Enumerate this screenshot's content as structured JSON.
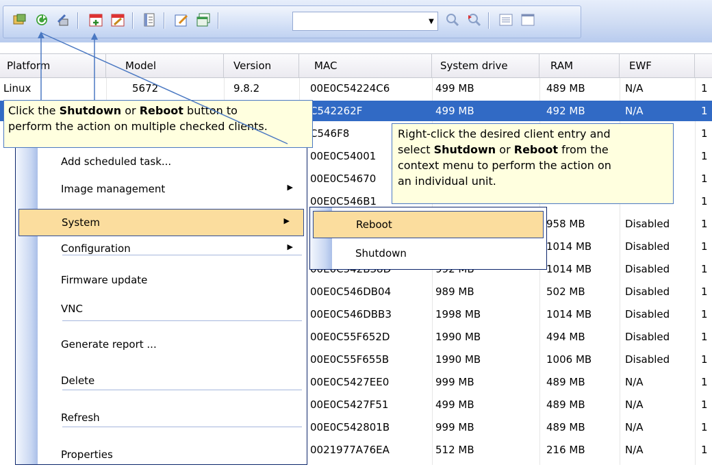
{
  "toolbar": {
    "icons": [
      "client-list-icon",
      "refresh-icon",
      "wrench-icon",
      "calendar-add-icon",
      "calendar-edit-icon",
      "report-icon",
      "edit-icon",
      "window-icon",
      "search-icon",
      "search-next-icon",
      "list-view-icon",
      "panel-icon"
    ],
    "combo_value": ""
  },
  "grid": {
    "headers": [
      "Platform",
      "Model",
      "Version",
      "MAC",
      "System drive",
      "RAM",
      "EWF"
    ],
    "rows": [
      {
        "platform": "Linux",
        "model": "5672",
        "version": "9.8.2",
        "mac": "00E0C54224C6",
        "drive": "499 MB",
        "ram": "489 MB",
        "ewf": "N/A",
        "extra": "1"
      },
      {
        "platform": "",
        "model": "",
        "version": "",
        "mac": "C542262F",
        "drive": "499 MB",
        "ram": "492 MB",
        "ewf": "N/A",
        "extra": "1"
      },
      {
        "platform": "",
        "model": "",
        "version": "",
        "mac": "C546F8",
        "drive": "",
        "ram": "",
        "ewf": "",
        "extra": "1"
      },
      {
        "platform": "",
        "model": "",
        "version": "",
        "mac": "00E0C54001",
        "drive": "",
        "ram": "",
        "ewf": "",
        "extra": "1"
      },
      {
        "platform": "",
        "model": "",
        "version": "",
        "mac": "00E0C54670",
        "drive": "",
        "ram": "",
        "ewf": "",
        "extra": "1"
      },
      {
        "platform": "",
        "model": "",
        "version": "",
        "mac": "00E0C546B1",
        "drive": "",
        "ram": "",
        "ewf": "",
        "extra": "1"
      },
      {
        "platform": "",
        "model": "",
        "version": "",
        "mac": "",
        "drive": "",
        "ram": "958 MB",
        "ewf": "Disabled",
        "extra": "1"
      },
      {
        "platform": "",
        "model": "",
        "version": "",
        "mac": "",
        "drive": "",
        "ram": "1014 MB",
        "ewf": "Disabled",
        "extra": "1"
      },
      {
        "platform": "",
        "model": "",
        "version": "",
        "mac": "00E0C542B38D",
        "drive": "992 MB",
        "ram": "1014 MB",
        "ewf": "Disabled",
        "extra": "1"
      },
      {
        "platform": "",
        "model": "",
        "version": "",
        "mac": "00E0C546DB04",
        "drive": "989 MB",
        "ram": "502 MB",
        "ewf": "Disabled",
        "extra": "1"
      },
      {
        "platform": "",
        "model": "",
        "version": "",
        "mac": "00E0C546DBB3",
        "drive": "1998 MB",
        "ram": "1014 MB",
        "ewf": "Disabled",
        "extra": "1"
      },
      {
        "platform": "",
        "model": "",
        "version": "",
        "mac": "00E0C55F652D",
        "drive": "1990 MB",
        "ram": "494 MB",
        "ewf": "Disabled",
        "extra": "1"
      },
      {
        "platform": "",
        "model": "",
        "version": "",
        "mac": "00E0C55F655B",
        "drive": "1990 MB",
        "ram": "1006 MB",
        "ewf": "Disabled",
        "extra": "1"
      },
      {
        "platform": "",
        "model": "",
        "version": "",
        "mac": "00E0C5427EE0",
        "drive": "999 MB",
        "ram": "489 MB",
        "ewf": "N/A",
        "extra": "1"
      },
      {
        "platform": "",
        "model": "",
        "version": "",
        "mac": "00E0C5427F51",
        "drive": "499 MB",
        "ram": "489 MB",
        "ewf": "N/A",
        "extra": "1"
      },
      {
        "platform": "",
        "model": "",
        "version": "",
        "mac": "00E0C542801B",
        "drive": "999 MB",
        "ram": "489 MB",
        "ewf": "N/A",
        "extra": "1"
      },
      {
        "platform": "",
        "model": "",
        "version": "",
        "mac": "0021977A76EA",
        "drive": "512 MB",
        "ram": "216 MB",
        "ewf": "N/A",
        "extra": "1"
      }
    ]
  },
  "context_menu": {
    "items": [
      {
        "label": "Add scheduled task...",
        "submenu": false
      },
      {
        "label": "Image management",
        "submenu": true
      },
      {
        "label": "System",
        "submenu": true,
        "active": true
      },
      {
        "label": "Configuration",
        "submenu": true
      },
      {
        "label": "Firmware update",
        "submenu": false
      },
      {
        "label": "VNC",
        "submenu": false
      },
      {
        "label": "Generate report ...",
        "submenu": false
      },
      {
        "label": "Delete",
        "submenu": false
      },
      {
        "label": "Refresh",
        "submenu": false
      },
      {
        "label": "Properties",
        "submenu": false
      }
    ]
  },
  "submenu": {
    "items": [
      {
        "label": "Reboot",
        "active": true
      },
      {
        "label": "Shutdown",
        "active": false
      }
    ]
  },
  "callouts": {
    "toolbar_pre": "Click the ",
    "toolbar_b1": "Shutdown",
    "toolbar_mid": " or ",
    "toolbar_b2": "Reboot",
    "toolbar_post": " button to",
    "toolbar_line2": "perform the action on multiple checked clients.",
    "ctx_line1": "Right-click the desired client entry and",
    "ctx_pre": "select ",
    "ctx_b1": "Shutdown",
    "ctx_mid": " or ",
    "ctx_b2": "Reboot",
    "ctx_post": " from the",
    "ctx_line3": "context menu to perform the action on",
    "ctx_line4": "an individual unit."
  },
  "colors": {
    "selection": "#316ac5",
    "menu_highlight": "#fbdd9e",
    "callout_bg": "#ffffdf"
  }
}
